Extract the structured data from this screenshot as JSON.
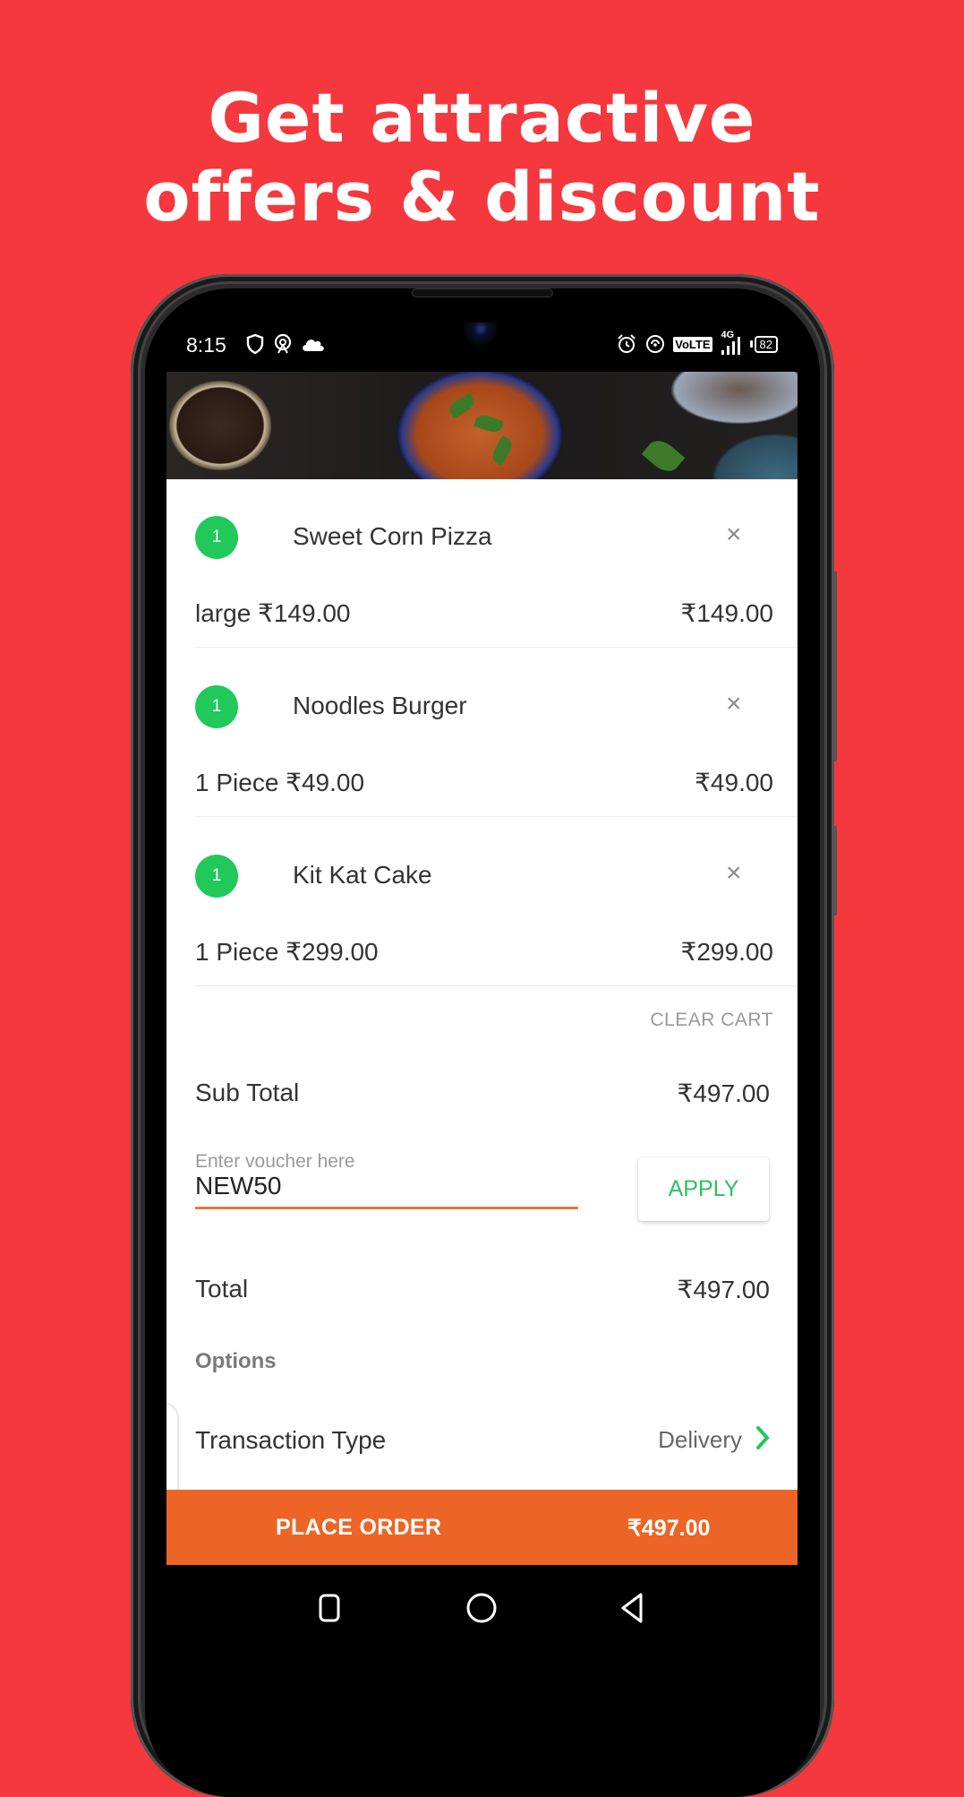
{
  "promo": {
    "headline_line1": "Get attractive",
    "headline_line2": "offers & discount"
  },
  "status_bar": {
    "time": "8:15",
    "left_icons": [
      "shield-icon",
      "hotspot-icon",
      "cloud-icon"
    ],
    "right_icons": [
      "alarm-icon",
      "wifi-calling-icon",
      "volte-icon",
      "signal-4g-icon"
    ],
    "volte_label": "VoLTE",
    "network_label": "4G",
    "battery": "82"
  },
  "cart": {
    "items": [
      {
        "qty": "1",
        "name": "Sweet Corn Pizza",
        "variant": "large ₹149.00",
        "price": "₹149.00"
      },
      {
        "qty": "1",
        "name": "Noodles Burger",
        "variant": "1 Piece ₹49.00",
        "price": "₹49.00"
      },
      {
        "qty": "1",
        "name": "Kit Kat Cake",
        "variant": "1 Piece ₹299.00",
        "price": "₹299.00"
      }
    ],
    "remove_icon": "×",
    "clear_cart_label": "CLEAR CART",
    "subtotal_label": "Sub Total",
    "subtotal_value": "₹497.00",
    "voucher": {
      "placeholder": "Enter voucher here",
      "value": "NEW50",
      "apply_label": "APPLY"
    },
    "total_label": "Total",
    "total_value": "₹497.00",
    "options_label": "Options",
    "transaction_type_label": "Transaction Type",
    "transaction_type_value": "Delivery"
  },
  "place_order": {
    "label": "PLACE ORDER",
    "amount": "₹497.00"
  },
  "colors": {
    "background": "#f5383d",
    "accent_green": "#20c95a",
    "place_order": "#ec6526",
    "voucher_underline": "#e8753a"
  }
}
